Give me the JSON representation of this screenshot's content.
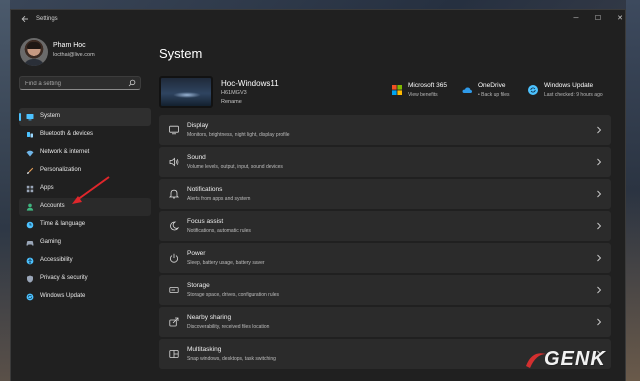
{
  "window": {
    "title": "Settings",
    "controls": {
      "minimize": "─",
      "maximize": "☐",
      "close": "✕"
    }
  },
  "profile": {
    "name": "Pham Hoc",
    "email": "locthai@live.com"
  },
  "search": {
    "placeholder": "Find a setting"
  },
  "sidebar": {
    "items": [
      {
        "label": "System",
        "icon": "monitor-icon",
        "color": "#4cc2ff",
        "active": true
      },
      {
        "label": "Bluetooth & devices",
        "icon": "bluetooth-icon",
        "color": "#4cc2ff"
      },
      {
        "label": "Network & internet",
        "icon": "network-icon",
        "color": "#6fb5e8"
      },
      {
        "label": "Personalization",
        "icon": "brush-icon",
        "color": "#e8a05a"
      },
      {
        "label": "Apps",
        "icon": "apps-icon",
        "color": "#9aa6b8"
      },
      {
        "label": "Accounts",
        "icon": "person-icon",
        "color": "#3fb57f"
      },
      {
        "label": "Time & language",
        "icon": "globe-clock-icon",
        "color": "#4cc2ff"
      },
      {
        "label": "Gaming",
        "icon": "gamepad-icon",
        "color": "#9aa6b8"
      },
      {
        "label": "Accessibility",
        "icon": "accessibility-icon",
        "color": "#4cc2ff"
      },
      {
        "label": "Privacy & security",
        "icon": "shield-icon",
        "color": "#9aa6b8"
      },
      {
        "label": "Windows Update",
        "icon": "update-icon",
        "color": "#4cc2ff"
      }
    ]
  },
  "main": {
    "title": "System",
    "device": {
      "name": "Hoc-Windows11",
      "model": "H61MGV3",
      "rename": "Rename"
    },
    "quick_status": [
      {
        "title": "Microsoft 365",
        "sub": "View benefits",
        "icon": "microsoft-365-icon"
      },
      {
        "title": "OneDrive",
        "sub": "• Back up files",
        "icon": "onedrive-icon"
      },
      {
        "title": "Windows Update",
        "sub": "Last checked: 9 hours ago",
        "icon": "windows-update-icon"
      }
    ],
    "settings": [
      {
        "title": "Display",
        "desc": "Monitors, brightness, night light, display profile",
        "icon": "display-icon"
      },
      {
        "title": "Sound",
        "desc": "Volume levels, output, input, sound devices",
        "icon": "speaker-icon"
      },
      {
        "title": "Notifications",
        "desc": "Alerts from apps and system",
        "icon": "bell-icon"
      },
      {
        "title": "Focus assist",
        "desc": "Notifications, automatic rules",
        "icon": "moon-icon"
      },
      {
        "title": "Power",
        "desc": "Sleep, battery usage, battery saver",
        "icon": "power-icon"
      },
      {
        "title": "Storage",
        "desc": "Storage space, drives, configuration rules",
        "icon": "storage-icon"
      },
      {
        "title": "Nearby sharing",
        "desc": "Discoverability, received files location",
        "icon": "share-icon"
      },
      {
        "title": "Multitasking",
        "desc": "Snap windows, desktops, task switching",
        "icon": "multitasking-icon"
      }
    ]
  },
  "watermark": {
    "text": "GENK"
  },
  "colors": {
    "accent": "#4cc2ff",
    "window_bg": "#202020",
    "card_bg": "#2b2b2b",
    "annotation_arrow": "#e0262b"
  }
}
